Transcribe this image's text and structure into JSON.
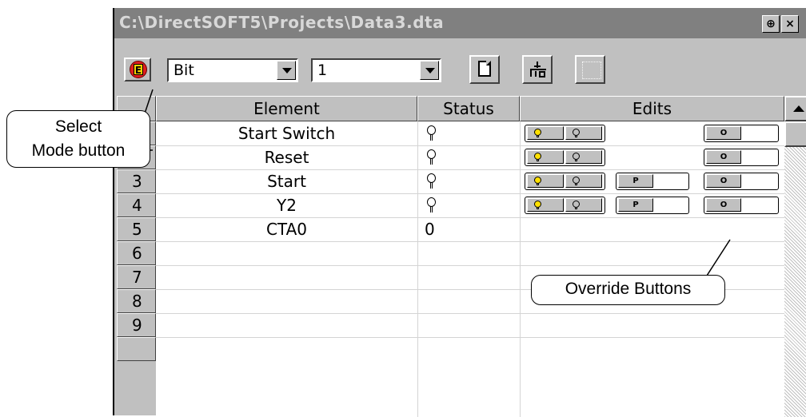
{
  "window": {
    "title": "C:\\DirectSOFT5\\Projects\\Data3.dta",
    "pin_glyph": "⊕",
    "close_glyph": "×"
  },
  "toolbar": {
    "mode_letter": "E",
    "type_value": "Bit",
    "format_value": "1",
    "icons": [
      "new-page-icon",
      "plc-write-icon",
      "disabled-grid-icon"
    ]
  },
  "columns": {
    "element": "Element",
    "status": "Status",
    "edits": "Edits"
  },
  "rows": [
    {
      "num": "1",
      "element": "Start Switch",
      "status_icon": "bulb-off-icon",
      "status": "",
      "edits": [
        "on-off",
        "override"
      ]
    },
    {
      "num": "2",
      "element": "Reset",
      "status_icon": "bulb-off-icon",
      "status": "",
      "edits": [
        "on-off",
        "override"
      ]
    },
    {
      "num": "3",
      "element": "Start",
      "status_icon": "bulb-off-icon",
      "status": "",
      "edits": [
        "on-off",
        "p",
        "override"
      ]
    },
    {
      "num": "4",
      "element": "Y2",
      "status_icon": "bulb-off-icon",
      "status": "",
      "edits": [
        "on-off",
        "p",
        "override"
      ]
    },
    {
      "num": "5",
      "element": "CTA0",
      "status_icon": "",
      "status": "0",
      "edits": []
    },
    {
      "num": "6",
      "element": "",
      "status": ""
    },
    {
      "num": "7",
      "element": "",
      "status": ""
    },
    {
      "num": "8",
      "element": "",
      "status": ""
    },
    {
      "num": "9",
      "element": "",
      "status": ""
    }
  ],
  "edit_buttons": {
    "p_label": "P",
    "o_label": "O"
  },
  "callouts": {
    "select_mode": "Select\nMode button",
    "override": "Override Buttons"
  },
  "colors": {
    "title_bg": "#808080",
    "window_bg": "#c0c0c0",
    "mode_button": "#e01e1e",
    "bulb_on": "#ffe000"
  }
}
